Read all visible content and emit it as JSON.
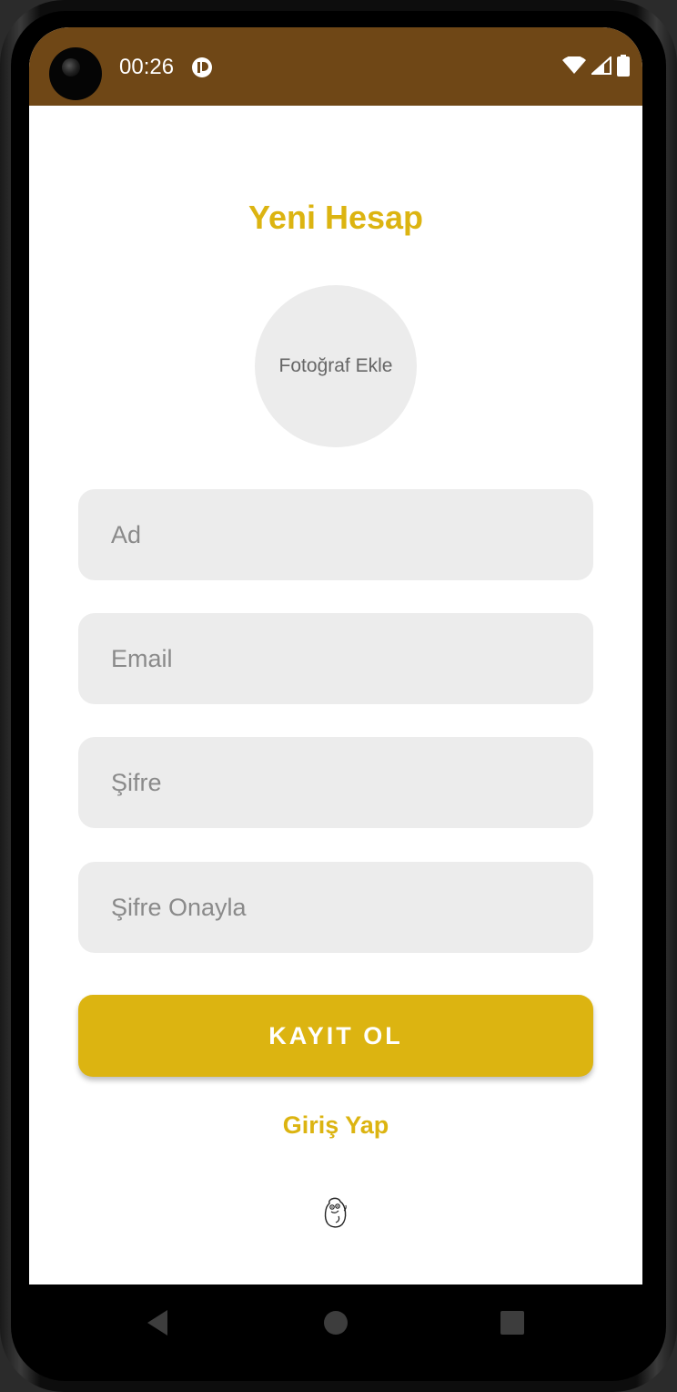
{
  "status_bar": {
    "time": "00:26"
  },
  "screen": {
    "title": "Yeni Hesap",
    "photo_label": "Fotoğraf Ekle",
    "fields": {
      "name_placeholder": "Ad",
      "email_placeholder": "Email",
      "password_placeholder": "Şifre",
      "confirm_password_placeholder": "Şifre Onayla"
    },
    "register_label": "KAYIT OL",
    "login_label": "Giriş Yap"
  },
  "colors": {
    "accent": "#dcb411",
    "status_bar": "#6f4716",
    "field_bg": "#ececec"
  },
  "icons": {
    "status": [
      "app-notification-icon",
      "wifi-icon",
      "cell-signal-icon",
      "battery-icon"
    ],
    "nav": [
      "back-icon",
      "home-icon",
      "recents-icon"
    ],
    "content": [
      "mascot-icon"
    ]
  }
}
